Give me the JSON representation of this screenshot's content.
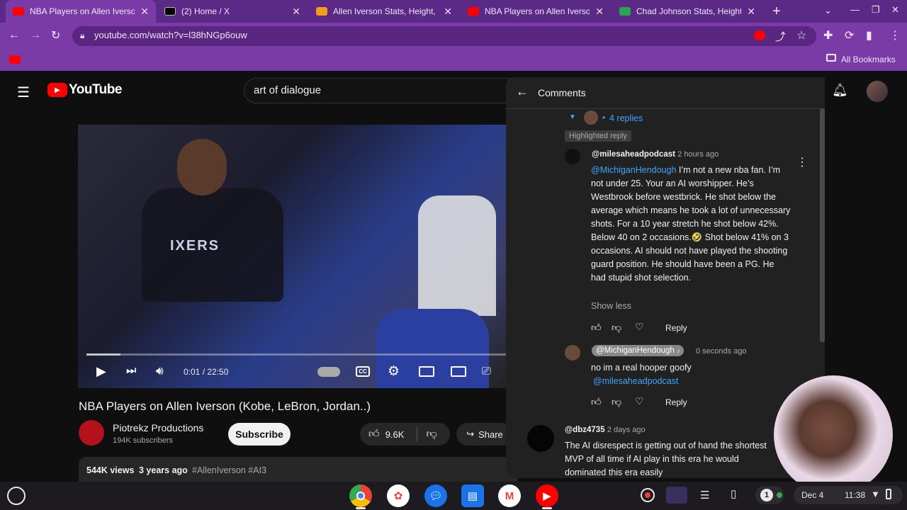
{
  "tabs": [
    {
      "title": "NBA Players on Allen Iverson",
      "color": "#ff0000"
    },
    {
      "title": "(2) Home / X",
      "color": "#000000"
    },
    {
      "title": "Allen Iverson Stats, Height, W",
      "color": "#f29c1f"
    },
    {
      "title": "NBA Players on Allen Iverson",
      "color": "#ff0000"
    },
    {
      "title": "Chad Johnson Stats, Height,",
      "color": "#2ea44f"
    }
  ],
  "browser": {
    "url": "youtube.com/watch?v=l38hNGp6ouw",
    "bookmarks_label": "All Bookmarks"
  },
  "youtube": {
    "logo": "YouTube",
    "search_value": "art of dialogue"
  },
  "video": {
    "time": "0:01 / 22:50",
    "overlay_text": "IXERS",
    "title": "NBA Players on Allen Iverson (Kobe, LeBron, Jordan..)",
    "channel": "Piotrekz Productions",
    "subscribers": "194K subscribers",
    "subscribe_label": "Subscribe",
    "likes": "9.6K",
    "share_label": "Share",
    "views": "544K views",
    "age": "3 years ago",
    "hashtags": "#AllenIverson #AI3"
  },
  "comments": {
    "header": "Comments",
    "replies_toggle": "4 replies",
    "highlighted_badge": "Highlighted reply",
    "c1": {
      "author": "@milesaheadpodcast",
      "time": "2 hours ago",
      "mention": "@MichiganHendough",
      "text": " I’m not a new nba fan. I’m not under 25. Your an AI worshipper. He’s Westbrook before westbrick. He shot below the average which means he took a lot of unnecessary shots. For a 10 year stretch he shot below 42%. Below 40 on 2 occasions.🤣 Shot below 41% on 3 occasions. AI should not have played the shooting guard position. He should have been a PG. He had stupid shot selection.",
      "show_less": "Show less",
      "reply_label": "Reply"
    },
    "c2": {
      "author": "@MichiganHendough",
      "time": "0 seconds ago",
      "text": "no im a real hooper goofy",
      "mention": "@milesaheadpodcast",
      "reply_label": "Reply"
    },
    "c3": {
      "author": "@dbz4735",
      "time": "2 days ago",
      "text": "The AI disrespect is getting out of hand the shortest MVP of all time if AI play in this era he would dominated this era easily"
    }
  },
  "shelf": {
    "notification_count": "1",
    "date": "Dec 4",
    "clock": "11:38"
  },
  "colors": {
    "browser_frame": "#7b3ba6",
    "youtube_red": "#ff0000",
    "link_blue": "#3ea6ff"
  }
}
